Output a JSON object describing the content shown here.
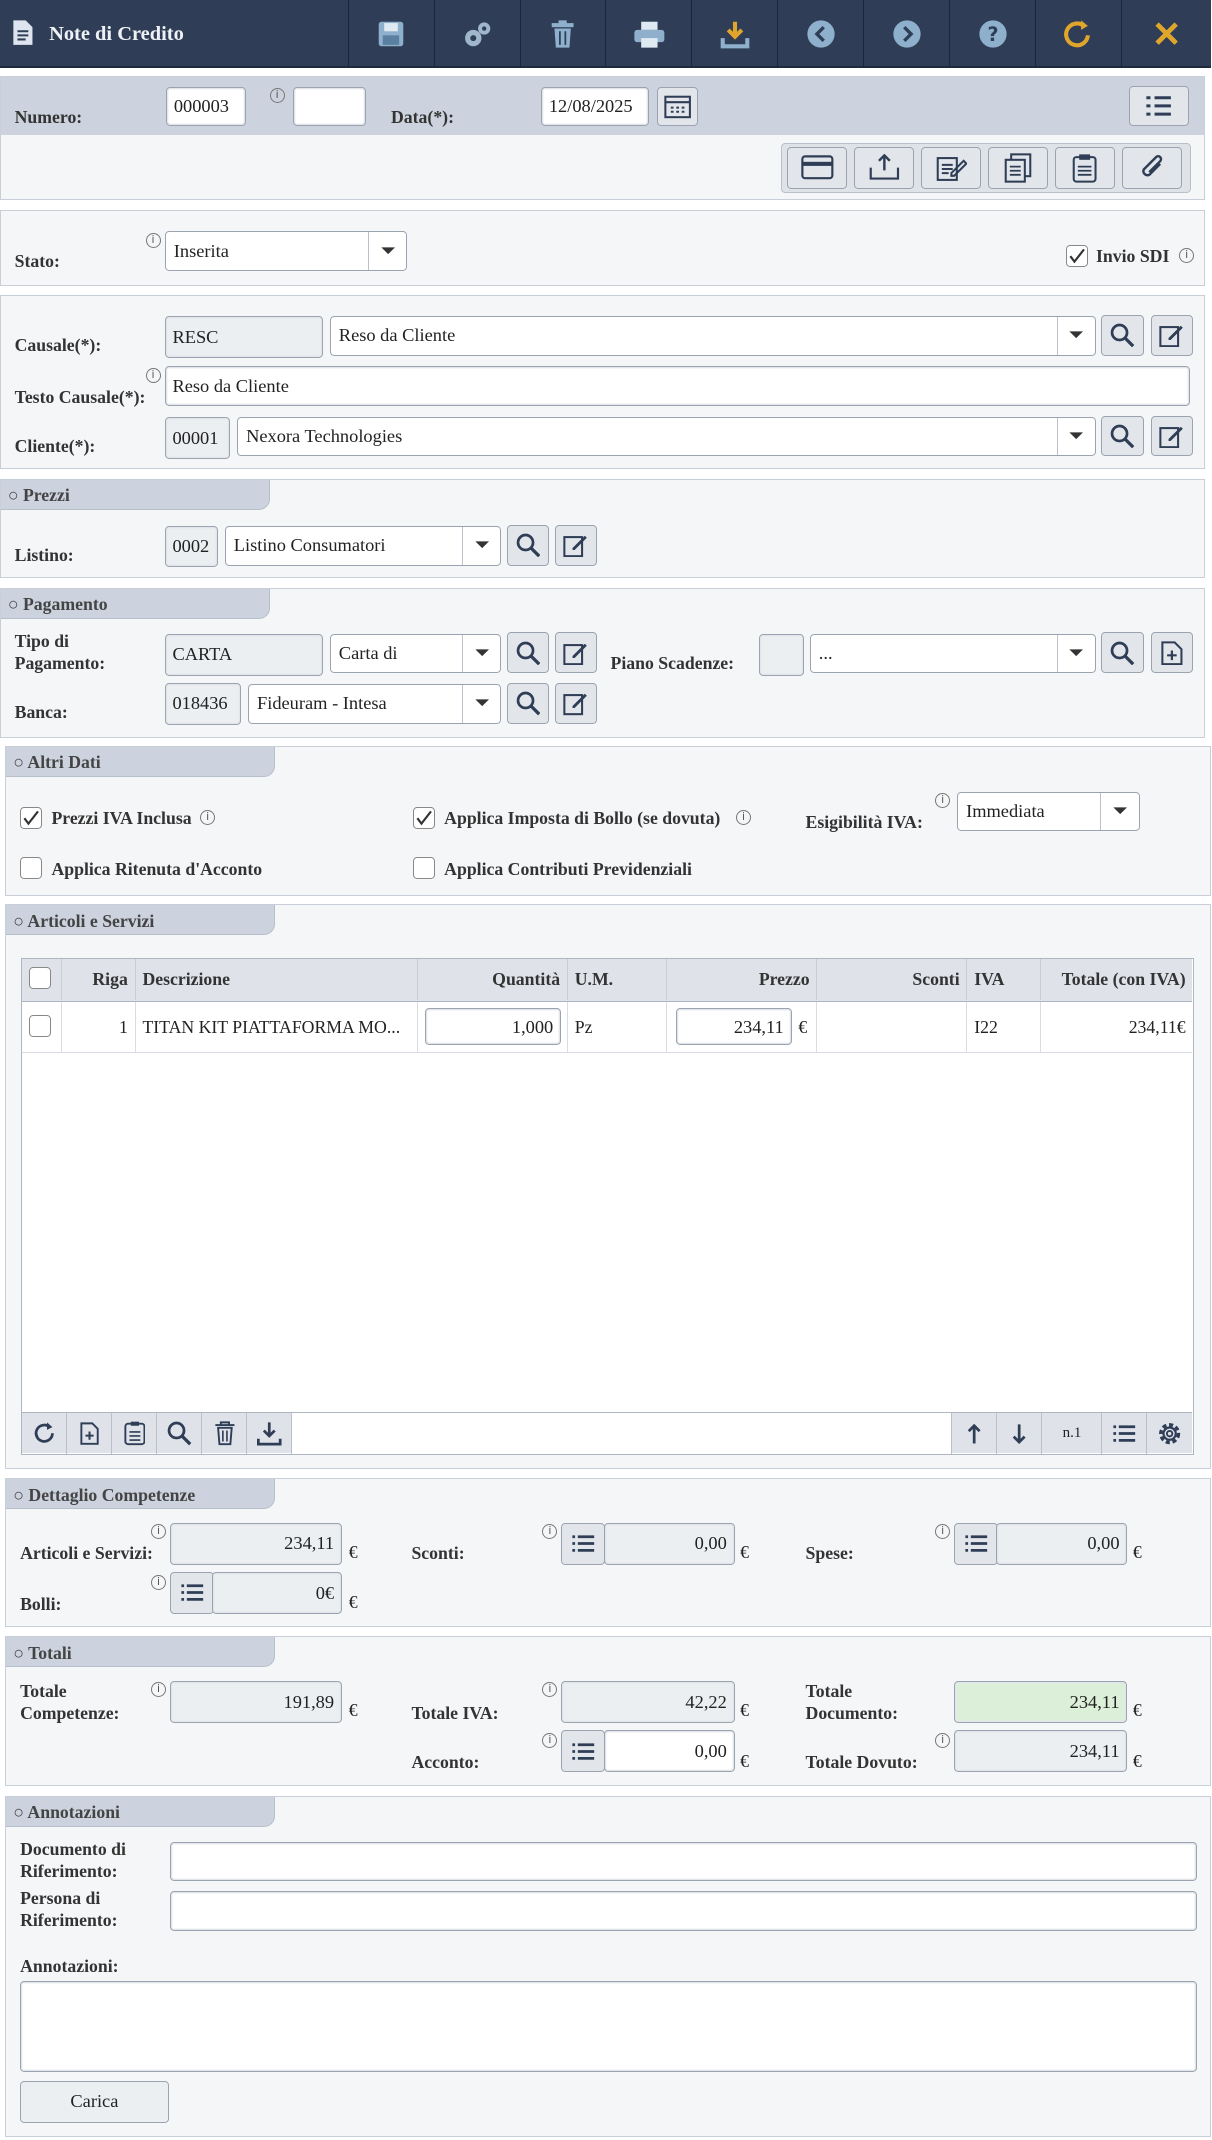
{
  "app": {
    "title": "Note di Credito"
  },
  "toolbar": [
    "save-icon",
    "settings-icon",
    "trash-icon",
    "print-icon",
    "download-icon",
    "prev-icon",
    "next-icon",
    "help-icon",
    "refresh-icon",
    "close-icon"
  ],
  "header": {
    "numero_label": "Numero:",
    "numero": "000003",
    "suffix": "",
    "data_label": "Data(*):",
    "data": "12/08/2025"
  },
  "stato": {
    "label": "Stato:",
    "value": "Inserita",
    "invio_sdi": "Invio SDI",
    "invio_sdi_checked": true
  },
  "causale": {
    "label": "Causale(*):",
    "code": "RESC",
    "value": "Reso da Cliente",
    "testo_label": "Testo Causale(*):",
    "testo": "Reso da Cliente"
  },
  "cliente": {
    "label": "Cliente(*):",
    "code": "00001",
    "value": "Nexora Technologies"
  },
  "prezzi": {
    "section": "○ Prezzi",
    "listino_label": "Listino:",
    "code": "0002",
    "value": "Listino Consumatori"
  },
  "pagamento": {
    "section": "○ Pagamento",
    "tipo_label_1": "Tipo di",
    "tipo_label_2": "Pagamento:",
    "tipo_code": "CARTA",
    "tipo_value": "Carta di",
    "piano_label": "Piano Scadenze:",
    "piano_value": "...",
    "banca_label": "Banca:",
    "banca_code": "018436",
    "banca_value": "Fideuram - Intesa"
  },
  "altri": {
    "section": "○ Altri Dati",
    "prezzi_iva": "Prezzi IVA Inclusa",
    "bollo": "Applica Imposta di Bollo (se dovuta)",
    "esig_label": "Esigibilità IVA:",
    "esig_value": "Immediata",
    "ritenuta": "Applica Ritenuta d'Acconto",
    "contributi": "Applica Contributi Previdenziali"
  },
  "articoli": {
    "section": "○ Articoli e Servizi",
    "columns": [
      "Riga",
      "Descrizione",
      "Quantità",
      "U.M.",
      "Prezzo",
      "Sconti",
      "IVA",
      "Totale (con IVA)"
    ],
    "rows": [
      {
        "riga": "1",
        "descrizione": "TITAN KIT PIATTAFORMA MO...",
        "quantita": "1,000",
        "um": "Pz",
        "prezzo": "234,11",
        "valuta": "€",
        "sconti": "",
        "iva": "I22",
        "totale": "234,11€"
      }
    ],
    "footer_count": "n.1"
  },
  "dettaglio": {
    "section": "○ Dettaglio Competenze",
    "articoli_label": "Articoli e Servizi:",
    "articoli": "234,11",
    "sconti_label": "Sconti:",
    "sconti": "0,00",
    "spese_label": "Spese:",
    "spese": "0,00",
    "bolli_label": "Bolli:",
    "bolli": "0€",
    "eur": "€"
  },
  "totali": {
    "section": "○ Totali",
    "comp_label_1": "Totale",
    "comp_label_2": "Competenze:",
    "competenze": "191,89",
    "iva_label": "Totale IVA:",
    "iva": "42,22",
    "doc_label_1": "Totale",
    "doc_label_2": "Documento:",
    "documento": "234,11",
    "acconto_label": "Acconto:",
    "acconto": "0,00",
    "dovuto_label": "Totale Dovuto:",
    "dovuto": "234,11"
  },
  "annotazioni": {
    "section": "○ Annotazioni",
    "doc_rif_1": "Documento di",
    "doc_rif_2": "Riferimento:",
    "pers_rif_1": "Persona di",
    "pers_rif_2": "Riferimento:",
    "annot_label": "Annotazioni:",
    "carica": "Carica"
  }
}
